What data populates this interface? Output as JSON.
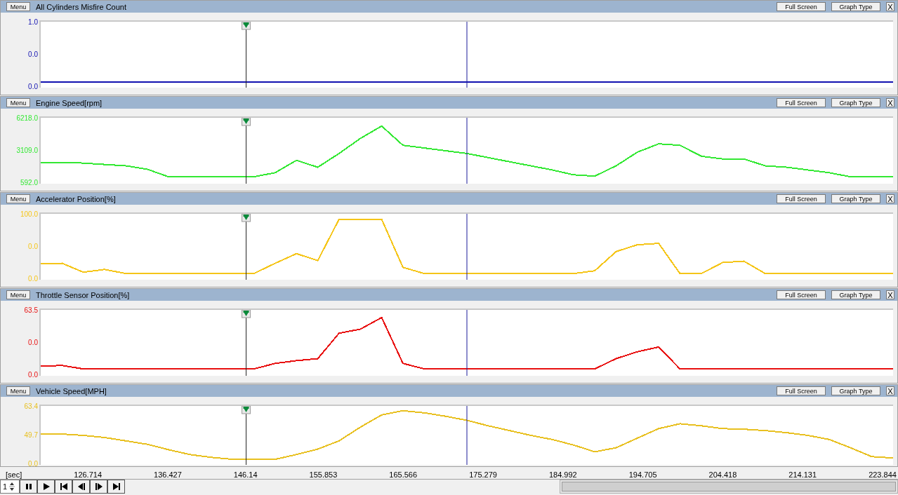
{
  "cursors": [
    {
      "kind": "marker"
    },
    {
      "kind": "line"
    }
  ],
  "panels": [
    {
      "menu": "Menu",
      "title": "All Cylinders Misfire Count",
      "full_screen": "Full Screen",
      "graph_type": "Graph Type",
      "close": "X",
      "color": "#1010b0",
      "y_labels": [
        "1.0",
        "0.0",
        "0.0"
      ]
    },
    {
      "menu": "Menu",
      "title": "Engine Speed[rpm]",
      "full_screen": "Full Screen",
      "graph_type": "Graph Type",
      "close": "X",
      "color": "#33e833",
      "y_labels": [
        "6218.0",
        "3109.0",
        "592.0"
      ]
    },
    {
      "menu": "Menu",
      "title": "Accelerator Position[%]",
      "full_screen": "Full Screen",
      "graph_type": "Graph Type",
      "close": "X",
      "color": "#f5c518",
      "y_labels": [
        "100.0",
        "0.0",
        "0.0"
      ]
    },
    {
      "menu": "Menu",
      "title": "Throttle Sensor Position[%]",
      "full_screen": "Full Screen",
      "graph_type": "Graph Type",
      "close": "X",
      "color": "#e81010",
      "y_labels": [
        "63.5",
        "0.0",
        "0.0"
      ]
    },
    {
      "menu": "Menu",
      "title": "Vehicle Speed[MPH]",
      "full_screen": "Full Screen",
      "graph_type": "Graph Type",
      "close": "X",
      "color": "#e8c020",
      "y_labels": [
        "63.4",
        "49.7",
        "0.0"
      ]
    }
  ],
  "time_axis": {
    "unit": "[sec]",
    "ticks": [
      "126.714",
      "136.427",
      "146.14",
      "155.853",
      "165.566",
      "175.279",
      "184.992",
      "194.705",
      "204.418",
      "214.131",
      "223.844"
    ]
  },
  "playback": {
    "speed": "1"
  }
}
